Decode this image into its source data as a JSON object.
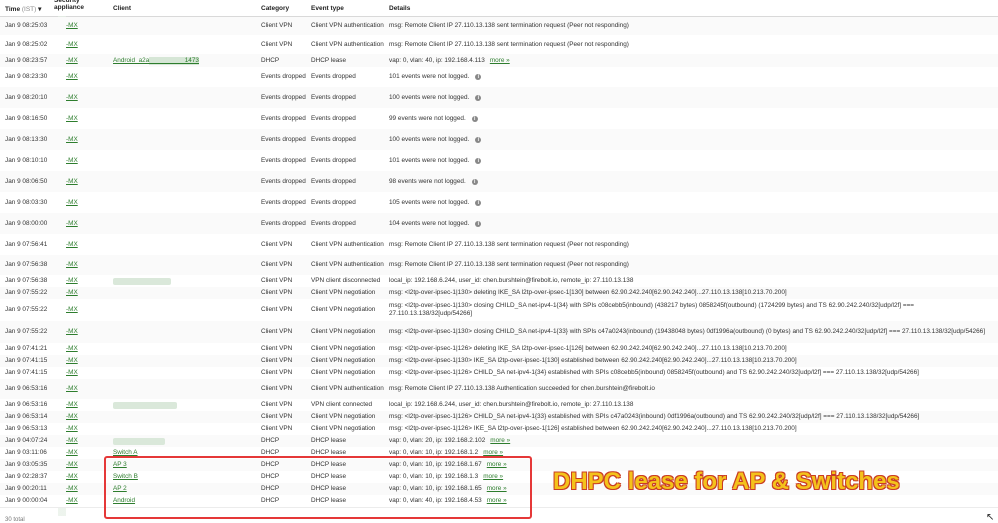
{
  "header": {
    "time": "Time",
    "tz": "(IST)",
    "sort_arrow": "▾",
    "appliance": "Security\nappliance",
    "client": "Client",
    "category": "Category",
    "event_type": "Event type",
    "details": "Details"
  },
  "rows": [
    {
      "time": "Jan 9 08:25:03",
      "appl": "-MX",
      "client": "",
      "cat": "Client VPN",
      "evt": "Client VPN authentication",
      "det": "msg: Remote Client IP 27.110.13.138 sent termination request (Peer not responding)",
      "more": "",
      "info": false,
      "h": 18
    },
    {
      "time": "Jan 9 08:25:02",
      "appl": "-MX",
      "client": "",
      "cat": "Client VPN",
      "evt": "Client VPN authentication",
      "det": "msg: Remote Client IP 27.110.13.138 sent termination request (Peer not responding)",
      "more": "",
      "info": false,
      "h": 19
    },
    {
      "time": "Jan 9 08:23:57",
      "appl": "-MX",
      "client": "Android_a2a                    1473",
      "cat": "DHCP",
      "evt": "DHCP lease",
      "det": "vap: 0, vlan: 40, ip: 192.168.4.113",
      "more": "more »",
      "info": false,
      "h": 13
    },
    {
      "time": "Jan 9 08:23:30",
      "appl": "-MX",
      "client": "",
      "cat": "Events dropped",
      "evt": "Events dropped",
      "det": "101 events were not logged.",
      "more": "",
      "info": true,
      "h": 20
    },
    {
      "time": "Jan 9 08:20:10",
      "appl": "-MX",
      "client": "",
      "cat": "Events dropped",
      "evt": "Events dropped",
      "det": "100 events were not logged.",
      "more": "",
      "info": true,
      "h": 21
    },
    {
      "time": "Jan 9 08:16:50",
      "appl": "-MX",
      "client": "",
      "cat": "Events dropped",
      "evt": "Events dropped",
      "det": "99 events were not logged.",
      "more": "",
      "info": true,
      "h": 21
    },
    {
      "time": "Jan 9 08:13:30",
      "appl": "-MX",
      "client": "",
      "cat": "Events dropped",
      "evt": "Events dropped",
      "det": "100 events were not logged.",
      "more": "",
      "info": true,
      "h": 21
    },
    {
      "time": "Jan 9 08:10:10",
      "appl": "-MX",
      "client": "",
      "cat": "Events dropped",
      "evt": "Events dropped",
      "det": "101 events were not logged.",
      "more": "",
      "info": true,
      "h": 21
    },
    {
      "time": "Jan 9 08:06:50",
      "appl": "-MX",
      "client": "",
      "cat": "Events dropped",
      "evt": "Events dropped",
      "det": "98 events were not logged.",
      "more": "",
      "info": true,
      "h": 21
    },
    {
      "time": "Jan 9 08:03:30",
      "appl": "-MX",
      "client": "",
      "cat": "Events dropped",
      "evt": "Events dropped",
      "det": "105 events were not logged.",
      "more": "",
      "info": true,
      "h": 21
    },
    {
      "time": "Jan 9 08:00:00",
      "appl": "-MX",
      "client": "",
      "cat": "Events dropped",
      "evt": "Events dropped",
      "det": "104 events were not logged.",
      "more": "",
      "info": true,
      "h": 21
    },
    {
      "time": "Jan 9 07:56:41",
      "appl": "-MX",
      "client": "",
      "cat": "Client VPN",
      "evt": "Client VPN authentication",
      "det": "msg: Remote Client IP 27.110.13.138 sent termination request (Peer not responding)",
      "more": "",
      "info": false,
      "h": 21
    },
    {
      "time": "Jan 9 07:56:38",
      "appl": "-MX",
      "client": "",
      "cat": "Client VPN",
      "evt": "Client VPN authentication",
      "det": "msg: Remote Client IP 27.110.13.138 sent termination request (Peer not responding)",
      "more": "",
      "info": false,
      "h": 20
    },
    {
      "time": "Jan 9 07:56:38",
      "appl": "-MX",
      "client": "BLUR",
      "cat": "Client VPN",
      "evt": "VPN client disconnected",
      "det": "local_ip: 192.168.6.244, user_id: chen.burshtein@firebolt.io, remote_ip: 27.110.13.138",
      "more": "",
      "info": false,
      "h": 12
    },
    {
      "time": "Jan 9 07:55:22",
      "appl": "-MX",
      "client": "",
      "cat": "Client VPN",
      "evt": "Client VPN negotiation",
      "det": "msg: <l2tp-over-ipsec-1|130> deleting IKE_SA l2tp-over-ipsec-1[130] between 62.90.242.240[62.90.242.240]...27.110.13.138[10.213.70.200]",
      "more": "",
      "info": false,
      "h": 12
    },
    {
      "time": "Jan 9 07:55:22",
      "appl": "-MX",
      "client": "",
      "cat": "Client VPN",
      "evt": "Client VPN negotiation",
      "det": "msg: <l2tp-over-ipsec-1|130> closing CHILD_SA net-ipv4-1{34} with SPIs c08cebb5(inbound) (438217 bytes) 0858245f(outbound) (1724299 bytes) and TS 62.90.242.240/32[udp/l2f] === 27.110.13.138/32[udp/54266]",
      "more": "",
      "info": false,
      "h": 22
    },
    {
      "time": "Jan 9 07:55:22",
      "appl": "-MX",
      "client": "",
      "cat": "Client VPN",
      "evt": "Client VPN negotiation",
      "det": "msg: <l2tp-over-ipsec-1|130> closing CHILD_SA net-ipv4-1{33} with SPIs c47a0243(inbound) (19438048 bytes) 0df1996a(outbound) (0 bytes) and TS 62.90.242.240/32[udp/l2f] === 27.110.13.138/32[udp/54266]",
      "more": "",
      "info": false,
      "h": 22
    },
    {
      "time": "Jan 9 07:41:21",
      "appl": "-MX",
      "client": "",
      "cat": "Client VPN",
      "evt": "Client VPN negotiation",
      "det": "msg: <l2tp-over-ipsec-1|126> deleting IKE_SA l2tp-over-ipsec-1[126] between 62.90.242.240[62.90.242.240]...27.110.13.138[10.213.70.200]",
      "more": "",
      "info": false,
      "h": 12
    },
    {
      "time": "Jan 9 07:41:15",
      "appl": "-MX",
      "client": "",
      "cat": "Client VPN",
      "evt": "Client VPN negotiation",
      "det": "msg: <l2tp-over-ipsec-1|130> IKE_SA l2tp-over-ipsec-1[130] established between 62.90.242.240[62.90.242.240]...27.110.13.138[10.213.70.200]",
      "more": "",
      "info": false,
      "h": 12
    },
    {
      "time": "Jan 9 07:41:15",
      "appl": "-MX",
      "client": "",
      "cat": "Client VPN",
      "evt": "Client VPN negotiation",
      "det": "msg: <l2tp-over-ipsec-1|126> CHILD_SA net-ipv4-1{34} established with SPIs c08cebb5(inbound) 0858245f(outbound) and TS 62.90.242.240/32[udp/l2f] === 27.110.13.138/32[udp/54266]",
      "more": "",
      "info": false,
      "h": 12
    },
    {
      "time": "Jan 9 06:53:16",
      "appl": "-MX",
      "client": "",
      "cat": "Client VPN",
      "evt": "Client VPN authentication",
      "det": "msg: Remote Client IP 27.110.13.138 Authentication succeeded for chen.burshtein@firebolt.io",
      "more": "",
      "info": false,
      "h": 20
    },
    {
      "time": "Jan 9 06:53:16",
      "appl": "-MX",
      "client": "BLUR",
      "cat": "Client VPN",
      "evt": "VPN client connected",
      "det": "local_ip: 192.168.6.244, user_id: chen.burshtein@firebolt.io, remote_ip: 27.110.13.138",
      "more": "",
      "info": false,
      "h": 12
    },
    {
      "time": "Jan 9 06:53:14",
      "appl": "-MX",
      "client": "",
      "cat": "Client VPN",
      "evt": "Client VPN negotiation",
      "det": "msg: <l2tp-over-ipsec-1|126> CHILD_SA net-ipv4-1{33} established with SPIs c47a0243(inbound) 0df1996a(outbound) and TS 62.90.242.240/32[udp/l2f] === 27.110.13.138/32[udp/54266]",
      "more": "",
      "info": false,
      "h": 12
    },
    {
      "time": "Jan 9 06:53:13",
      "appl": "-MX",
      "client": "",
      "cat": "Client VPN",
      "evt": "Client VPN negotiation",
      "det": "msg: <l2tp-over-ipsec-1|126> IKE_SA l2tp-over-ipsec-1[126] established between 62.90.242.240[62.90.242.240]...27.110.13.138[10.213.70.200]",
      "more": "",
      "info": false,
      "h": 12
    },
    {
      "time": "Jan 9 04:07:24",
      "appl": "-MX",
      "client": "BLUR",
      "cat": "DHCP",
      "evt": "DHCP lease",
      "det": "vap: 0, vlan: 20, ip: 192.168.2.102",
      "more": "more »",
      "info": false,
      "h": 12
    },
    {
      "time": "Jan 9 03:11:06",
      "appl": "-MX",
      "client": "Switch A",
      "cat": "DHCP",
      "evt": "DHCP lease",
      "det": "vap: 0, vlan: 10, ip: 192.168.1.2",
      "more": "more »",
      "info": false,
      "h": 12
    },
    {
      "time": "Jan 9 03:05:35",
      "appl": "-MX",
      "client": "AP 3",
      "cat": "DHCP",
      "evt": "DHCP lease",
      "det": "vap: 0, vlan: 10, ip: 192.168.1.67",
      "more": "more »",
      "info": false,
      "h": 12
    },
    {
      "time": "Jan 9 02:28:37",
      "appl": "-MX",
      "client": "Switch B",
      "cat": "DHCP",
      "evt": "DHCP lease",
      "det": "vap: 0, vlan: 10, ip: 192.168.1.3",
      "more": "more »",
      "info": false,
      "h": 12
    },
    {
      "time": "Jan 9 00:20:11",
      "appl": "-MX",
      "client": "AP 2",
      "cat": "DHCP",
      "evt": "DHCP lease",
      "det": "vap: 0, vlan: 10, ip: 192.168.1.65",
      "more": "more »",
      "info": false,
      "h": 12
    },
    {
      "time": "Jan 9 00:00:04",
      "appl": "-MX",
      "client": "Android",
      "cat": "DHCP",
      "evt": "DHCP lease",
      "det": "vap: 0, vlan: 40, ip: 192.168.4.53",
      "more": "more »",
      "info": false,
      "h": 12
    }
  ],
  "callout": "DHPC lease for AP & Switches",
  "footer": "30 total"
}
